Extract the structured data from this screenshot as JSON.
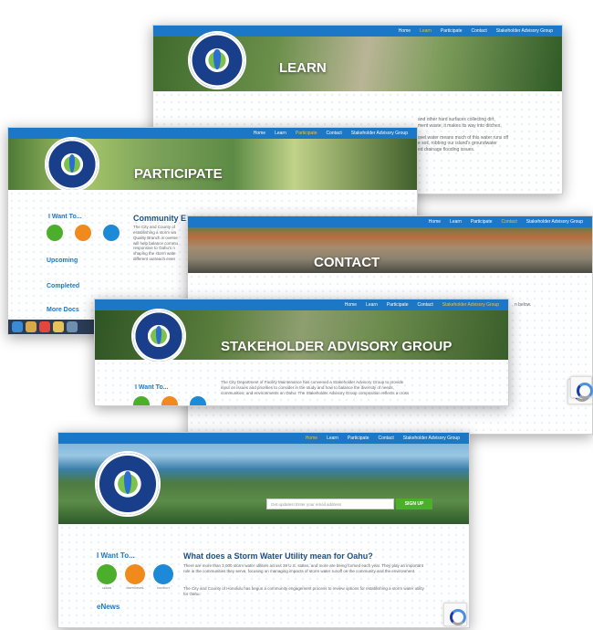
{
  "learn": {
    "nav": [
      "Home",
      "Learn",
      "Participate",
      "Contact",
      "Stakeholder Advisory Group"
    ],
    "active": 1,
    "title": "LEARN",
    "text_lines": [
      "and other hard surfaces collecting dirt,",
      "ment waste, it makes its way into ditches,",
      "",
      "ovel water means much of this water runs off",
      "e soil, robbing our island's groundwater",
      "ed drainage flooding issues."
    ]
  },
  "participate": {
    "nav": [
      "Home",
      "Learn",
      "Participate",
      "Contact",
      "Stakeholder Advisory Group"
    ],
    "active": 2,
    "title": "PARTICIPATE",
    "i_want_to": "I Want To...",
    "upcoming": "Upcoming",
    "completed": "Completed",
    "more": "More Docs",
    "heading": "Community E",
    "text_lines": [
      "The City and County of",
      "establishing a storm wa",
      "Quality Branch is overse",
      "will help balance commu",
      "responsive to Oahu's n",
      "shaping the storm wate",
      "different outreach even"
    ]
  },
  "contact": {
    "nav": [
      "Home",
      "Learn",
      "Participate",
      "Contact",
      "Stakeholder Advisory Group"
    ],
    "active": 3,
    "title": "CONTACT",
    "side_text": "n below."
  },
  "stakeholder": {
    "nav": [
      "Home",
      "Learn",
      "Participate",
      "Contact",
      "Stakeholder Advisory Group"
    ],
    "active": 4,
    "title": "STAKEHOLDER ADVISORY GROUP",
    "i_want_to": "I Want To...",
    "text_lines": [
      "The City Department of Facility Maintenance has convened a Stakeholder Advisory Group to provide",
      "input on issues and priorities to consider in the study and how to balance the diversity of needs,",
      "communities, and environments on Oahu. The Stakeholder Advisory Group composition reflects a cross"
    ]
  },
  "home": {
    "nav": [
      "Home",
      "Learn",
      "Participate",
      "Contact",
      "Stakeholder Advisory Group"
    ],
    "active": 0,
    "email_placeholder": "Get updates! Enter your email address",
    "signup": "SIGN UP",
    "i_want_to": "I Want To...",
    "icons": [
      {
        "icon": "lightbulb-icon",
        "label": "LEARN",
        "color": "#4caf2b"
      },
      {
        "icon": "people-icon",
        "label": "PARTICIPATE",
        "color": "#f08a1c"
      },
      {
        "icon": "envelope-icon",
        "label": "CONTACT",
        "color": "#1c8ad6"
      }
    ],
    "enews": "eNews",
    "heading": "What does a Storm Water Utility mean for Oahu?",
    "para1": "There are more than 2,000 storm water utilities across 39 U.S. states, and more are being formed each year. They play an important role in the communities they serve, focusing on managing impacts of storm water runoff on the community and the environment.",
    "para2": "The City and County of Honolulu has begun a community engagement process to review options for establishing a storm water utility for Oahu."
  },
  "logo_text": "STORM WATER UTILITY",
  "logo_sub": "OAHU"
}
